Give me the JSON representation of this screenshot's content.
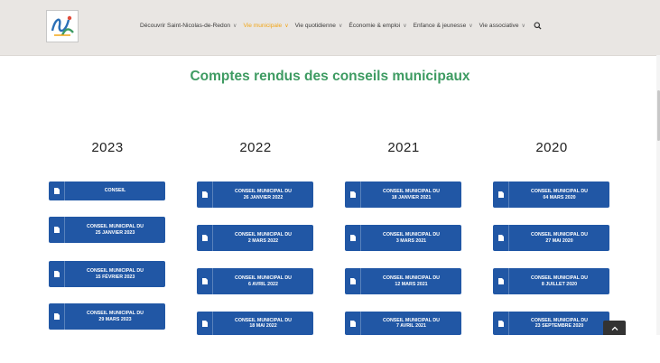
{
  "nav": {
    "items": [
      {
        "label": "Découvrir Saint-Nicolas-de-Redon",
        "active": false
      },
      {
        "label": "Vie municipale",
        "active": true
      },
      {
        "label": "Vie quotidienne",
        "active": false
      },
      {
        "label": "Économie & emploi",
        "active": false
      },
      {
        "label": "Enfance & jeunesse",
        "active": false
      },
      {
        "label": "Vie associative",
        "active": false
      }
    ],
    "search_icon": "search-icon"
  },
  "page": {
    "title": "Comptes rendus des conseils municipaux"
  },
  "colors": {
    "accent_green": "#3e9b62",
    "button_blue": "#2157a5",
    "nav_active": "#f2a516"
  },
  "years": [
    {
      "year": "2023",
      "buttons": [
        "CONSEIL",
        "CONSEIL MUNICIPAL DU\n25 JANVIER 2023",
        "CONSEIL MUNICIPAL DU\n15 FÉVRIER 2023",
        "CONSEIL MUNICIPAL DU\n29 MARS 2023"
      ]
    },
    {
      "year": "2022",
      "buttons": [
        "CONSEIL MUNICIPAL DU\n26 JANVIER 2022",
        "CONSEIL MUNICIPAL DU\n2 MARS 2022",
        "CONSEIL MUNICIPAL DU\n6 AVRIL 2022",
        "CONSEIL MUNICIPAL DU\n18 MAI 2022"
      ]
    },
    {
      "year": "2021",
      "buttons": [
        "CONSEIL MUNICIPAL DU\n18 JANVIER 2021",
        "CONSEIL MUNICIPAL DU\n3 MARS 2021",
        "CONSEIL MUNICIPAL DU\n12 MARS 2021",
        "CONSEIL MUNICIPAL DU\n7 AVRIL 2021"
      ]
    },
    {
      "year": "2020",
      "buttons": [
        "CONSEIL MUNICIPAL DU\n04 MARS 2020",
        "CONSEIL MUNICIPAL DU\n27 MAI 2020",
        "CONSEIL MUNICIPAL DU\n8 JUILLET 2020",
        "CONSEIL MUNICIPAL DU\n23 SEPTEMBRE 2020"
      ]
    }
  ]
}
